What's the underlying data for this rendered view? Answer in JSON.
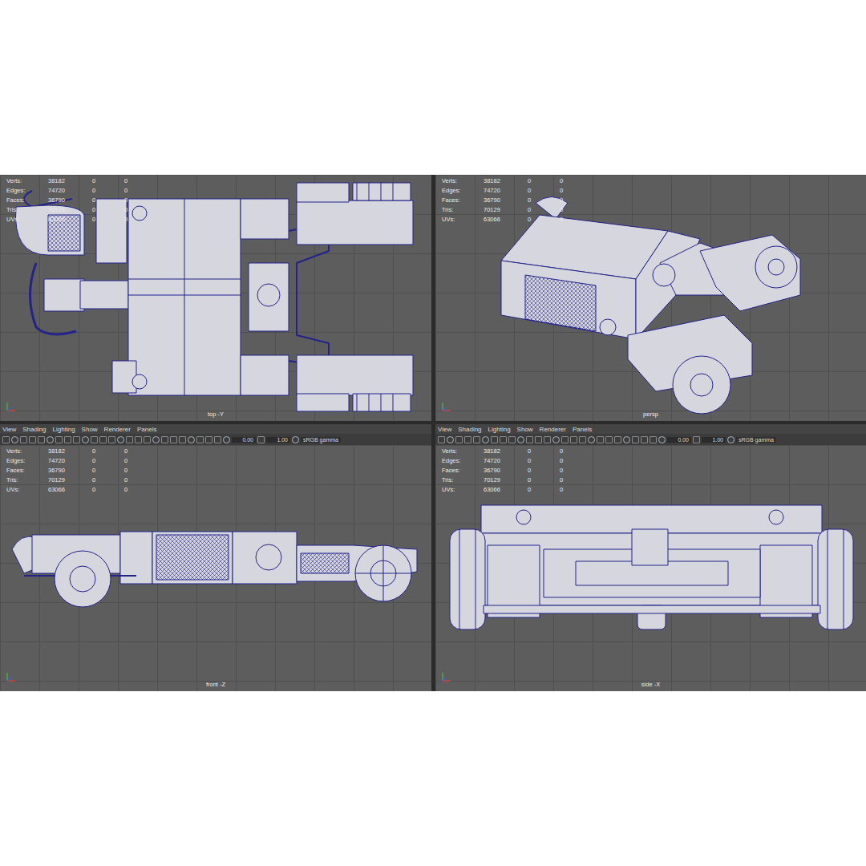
{
  "viewports": [
    {
      "label": "top -Y",
      "kind": "top",
      "has_menu": false,
      "stats": [
        {
          "label": "Verts:",
          "values": [
            "38182",
            "0",
            "0"
          ]
        },
        {
          "label": "Edges:",
          "values": [
            "74720",
            "0",
            "0"
          ]
        },
        {
          "label": "Faces:",
          "values": [
            "36790",
            "0",
            "0"
          ]
        },
        {
          "label": "Tris:",
          "values": [
            "70129",
            "0",
            "0"
          ]
        },
        {
          "label": "UVs:",
          "values": [
            "63066",
            "0",
            "0"
          ]
        }
      ]
    },
    {
      "label": "persp",
      "kind": "persp",
      "has_menu": false,
      "stats": [
        {
          "label": "Verts:",
          "values": [
            "38182",
            "0",
            "0"
          ]
        },
        {
          "label": "Edges:",
          "values": [
            "74720",
            "0",
            "0"
          ]
        },
        {
          "label": "Faces:",
          "values": [
            "36790",
            "0",
            "0"
          ]
        },
        {
          "label": "Tris:",
          "values": [
            "70129",
            "0",
            "0"
          ]
        },
        {
          "label": "UVs:",
          "values": [
            "63066",
            "0",
            "0"
          ]
        }
      ]
    },
    {
      "label": "front -Z",
      "kind": "front",
      "has_menu": true,
      "stats": [
        {
          "label": "Verts:",
          "values": [
            "38182",
            "0",
            "0"
          ]
        },
        {
          "label": "Edges:",
          "values": [
            "74720",
            "0",
            "0"
          ]
        },
        {
          "label": "Faces:",
          "values": [
            "36790",
            "0",
            "0"
          ]
        },
        {
          "label": "Tris:",
          "values": [
            "70129",
            "0",
            "0"
          ]
        },
        {
          "label": "UVs:",
          "values": [
            "63066",
            "0",
            "0"
          ]
        }
      ]
    },
    {
      "label": "side -X",
      "kind": "side",
      "has_menu": true,
      "stats": [
        {
          "label": "Verts:",
          "values": [
            "38182",
            "0",
            "0"
          ]
        },
        {
          "label": "Edges:",
          "values": [
            "74720",
            "0",
            "0"
          ]
        },
        {
          "label": "Faces:",
          "values": [
            "36790",
            "0",
            "0"
          ]
        },
        {
          "label": "Tris:",
          "values": [
            "70129",
            "0",
            "0"
          ]
        },
        {
          "label": "UVs:",
          "values": [
            "63066",
            "0",
            "0"
          ]
        }
      ]
    }
  ],
  "menu": [
    "View",
    "Shading",
    "Lighting",
    "Show",
    "Renderer",
    "Panels"
  ],
  "toolbar": {
    "exposure": "0.00",
    "gamma": "1.00",
    "color_space": "sRGB gamma"
  }
}
